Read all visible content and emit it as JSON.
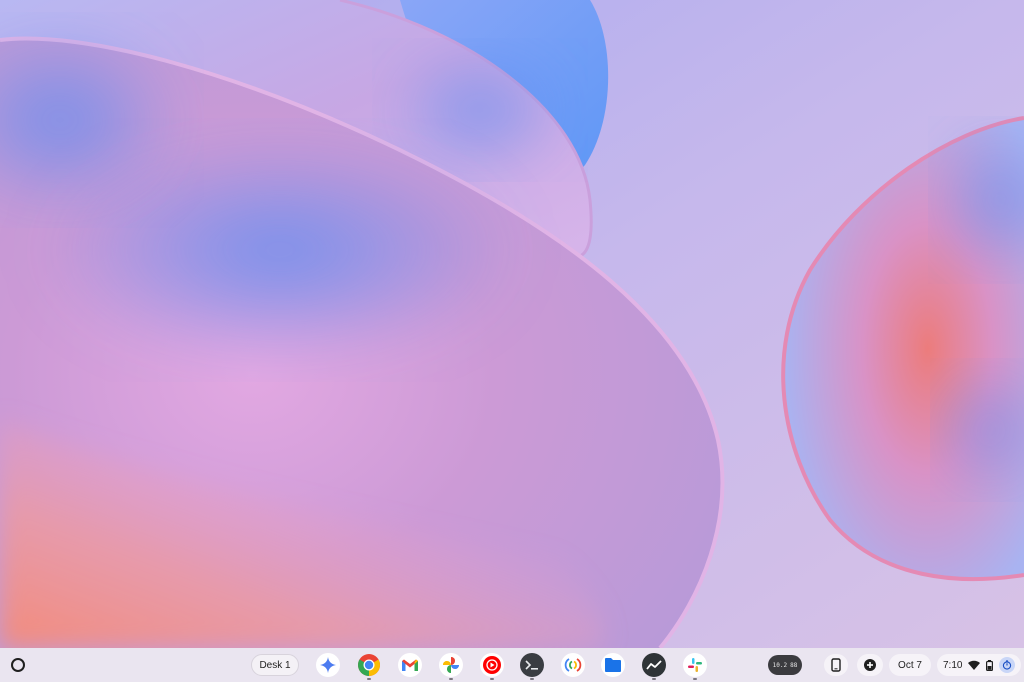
{
  "shelf": {
    "launcher_icon": "launcher-circle-icon",
    "desk_label": "Desk 1",
    "apps": [
      {
        "name": "gemini",
        "icon": "gemini-sparkle-icon"
      },
      {
        "name": "chrome",
        "icon": "chrome-icon"
      },
      {
        "name": "gmail",
        "icon": "gmail-icon"
      },
      {
        "name": "photos",
        "icon": "google-photos-icon"
      },
      {
        "name": "youtube-music",
        "icon": "youtube-music-icon"
      },
      {
        "name": "terminal",
        "icon": "terminal-icon"
      },
      {
        "name": "nearby-share",
        "icon": "nearby-share-icon"
      },
      {
        "name": "files",
        "icon": "files-folder-icon"
      },
      {
        "name": "stocks",
        "icon": "stocks-chart-icon"
      },
      {
        "name": "slack",
        "icon": "slack-icon"
      }
    ]
  },
  "tray": {
    "capture_left": "10.2",
    "capture_right": "88",
    "date": "Oct 7",
    "time": "7:10"
  },
  "colors": {
    "shelf_bg": "#ece8f0",
    "chrome_red": "#ea4335",
    "chrome_yellow": "#fbbc04",
    "chrome_green": "#34a853",
    "chrome_blue": "#4285f4",
    "files_blue": "#1a73e8",
    "ytm_red": "#ff0000"
  }
}
